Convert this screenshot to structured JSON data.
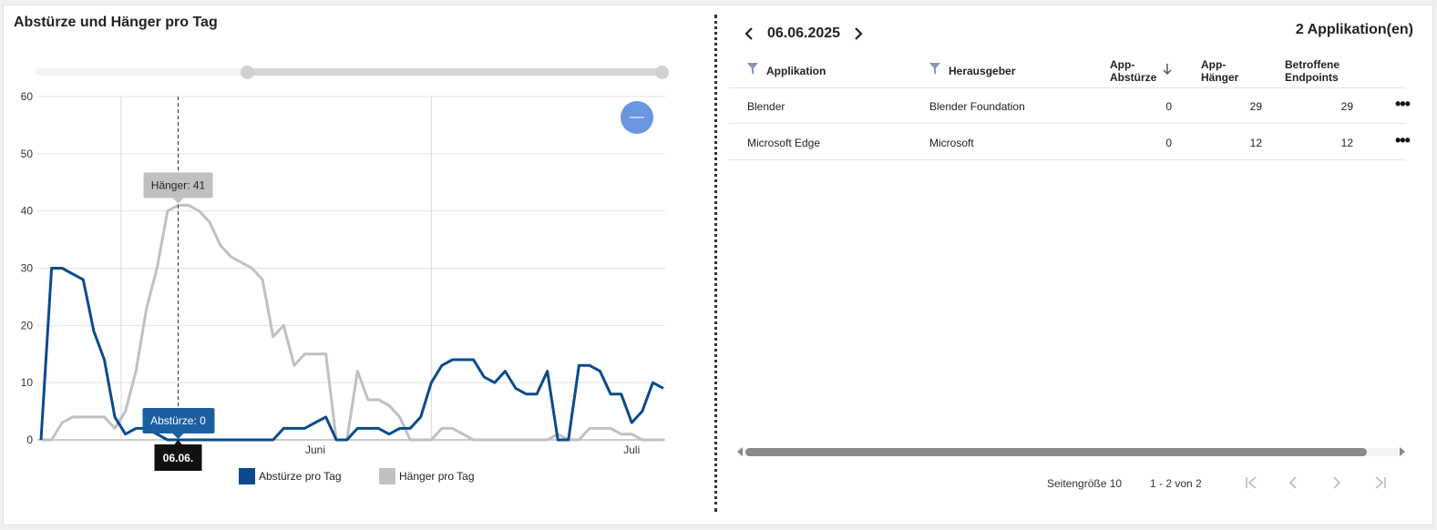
{
  "chart_panel": {
    "title": "Abstürze und Hänger pro Tag",
    "collapse_button": "—"
  },
  "chart_data": {
    "type": "line",
    "title": "Abstürze und Hänger pro Tag",
    "y_ticks": [
      "60",
      "50",
      "40",
      "30",
      "20",
      "10",
      "0"
    ],
    "ylim": [
      0,
      60
    ],
    "x_tick_labels": [
      {
        "label": "Juni",
        "index": 26
      },
      {
        "label": "Juli",
        "index": 56
      }
    ],
    "series": [
      {
        "name": "Abstürze pro Tag",
        "color": "#0b4a8c",
        "values": [
          0,
          30,
          30,
          29,
          28,
          19,
          14,
          4,
          1,
          2,
          2,
          1,
          0,
          0,
          0,
          0,
          0,
          0,
          0,
          0,
          0,
          0,
          0,
          2,
          2,
          2,
          3,
          4,
          0,
          0,
          2,
          2,
          2,
          1,
          2,
          2,
          4,
          10,
          13,
          14,
          14,
          14,
          11,
          10,
          12,
          9,
          8,
          8,
          12,
          0,
          0,
          13,
          13,
          12,
          8,
          8,
          3,
          5,
          10,
          9
        ]
      },
      {
        "name": "Hänger pro Tag",
        "color": "#c0c0c0",
        "values": [
          0,
          0,
          3,
          4,
          4,
          4,
          4,
          2,
          5,
          12,
          23,
          30,
          40,
          41,
          41,
          40,
          38,
          34,
          32,
          31,
          30,
          28,
          18,
          20,
          13,
          15,
          15,
          15,
          0,
          0,
          12,
          7,
          7,
          6,
          4,
          0,
          0,
          0,
          2,
          2,
          1,
          0,
          0,
          0,
          0,
          0,
          0,
          0,
          0,
          1,
          0,
          0,
          2,
          2,
          2,
          1,
          1,
          0,
          0,
          0
        ]
      }
    ],
    "hover": {
      "index": 13,
      "date_label": "06.06.",
      "tooltip_haenger": "Hänger: 41",
      "tooltip_abstuerze": "Abstürze: 0"
    },
    "grid": true,
    "legend_position": "bottom-center"
  },
  "legend": [
    {
      "label": "Abstürze pro Tag",
      "color": "#0b4a8c"
    },
    {
      "label": "Hänger pro Tag",
      "color": "#c0c0c0"
    }
  ],
  "table_panel": {
    "date": "06.06.2025",
    "app_count": "2 Applikation(en)",
    "columns": {
      "app": "Applikation",
      "publisher": "Herausgeber",
      "crashes_1": "App-",
      "crashes_2": "Abstürze",
      "hangs_1": "App-",
      "hangs_2": "Hänger",
      "endpoints_1": "Betroffene",
      "endpoints_2": "Endpoints"
    },
    "rows": [
      {
        "app": "Blender",
        "publisher": "Blender Foundation",
        "crashes": "0",
        "hangs": "29",
        "endpoints": "29",
        "more": "•••"
      },
      {
        "app": "Microsoft Edge",
        "publisher": "Microsoft",
        "crashes": "0",
        "hangs": "12",
        "endpoints": "12",
        "more": "•••"
      }
    ],
    "pager": {
      "page_size": "Seitengröße 10",
      "range": "1 - 2 von 2"
    }
  }
}
